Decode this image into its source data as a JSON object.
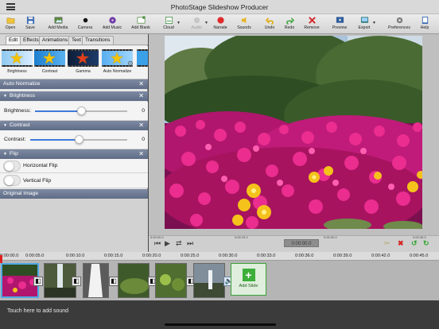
{
  "app": {
    "title": "PhotoStage Slideshow Producer"
  },
  "toolbar": {
    "items": [
      {
        "label": "Open",
        "icon": "folder-icon"
      },
      {
        "label": "Save",
        "icon": "floppy-icon"
      },
      {
        "label": "Add Media",
        "icon": "add-media-icon"
      },
      {
        "label": "Camera",
        "icon": "camera-icon"
      },
      {
        "label": "Add Music",
        "icon": "music-icon"
      },
      {
        "label": "Add Blank",
        "icon": "blank-slide-icon"
      },
      {
        "label": "Cloud",
        "icon": "cloud-icon"
      },
      {
        "label": "Audio",
        "icon": "audio-icon"
      },
      {
        "label": "Narrate",
        "icon": "record-icon"
      },
      {
        "label": "Sounds",
        "icon": "sounds-icon"
      },
      {
        "label": "Undo",
        "icon": "undo-icon"
      },
      {
        "label": "Redo",
        "icon": "redo-icon"
      },
      {
        "label": "Remove",
        "icon": "remove-icon"
      },
      {
        "label": "Preview",
        "icon": "preview-icon"
      },
      {
        "label": "Export",
        "icon": "export-icon"
      },
      {
        "label": "Preferences",
        "icon": "preferences-icon"
      },
      {
        "label": "Help",
        "icon": "help-icon"
      }
    ]
  },
  "tabs": [
    "Edit",
    "Effects",
    "Animations",
    "Text",
    "Transitions"
  ],
  "effects": [
    "Brightness",
    "Contrast",
    "Gamma",
    "Auto Normalize"
  ],
  "panel": {
    "auto_normalize": "Auto Normalize",
    "brightness": {
      "header": "Brightness",
      "label": "Brightness:",
      "value": "0",
      "level": 0.5
    },
    "contrast": {
      "header": "Contrast",
      "label": "Contrast:",
      "value": "0",
      "level": 0.5
    },
    "flip": {
      "header": "Flip",
      "horizontal": "Horizontal Flip",
      "vertical": "Vertical Flip"
    },
    "original": "Original Image",
    "close_glyph": "✕"
  },
  "preview": {
    "time": "0:00:00.0",
    "mini_ticks": [
      "0:00:00.0",
      "0:00:15.0",
      "0:00:30.0",
      "0:00:45.0"
    ]
  },
  "ruler": {
    "ticks": [
      "0:00:00.0",
      "0:00:05.0",
      "0:00:10.0",
      "0:00:15.0",
      "0:00:20.0",
      "0:00:25.0",
      "0:00:30.0",
      "0:00:33.0",
      "0:00:36.0",
      "0:00:39.0",
      "0:00:42.0",
      "0:00:45.0"
    ]
  },
  "timeline": {
    "add_slide": "Add Slide"
  },
  "audio": {
    "hint": "Touch here to add sound"
  },
  "colors": {
    "accent": "#3f7ad9",
    "section": "#6b7791",
    "add_slide": "#3cae3a",
    "selection": "#4ea9e2"
  }
}
